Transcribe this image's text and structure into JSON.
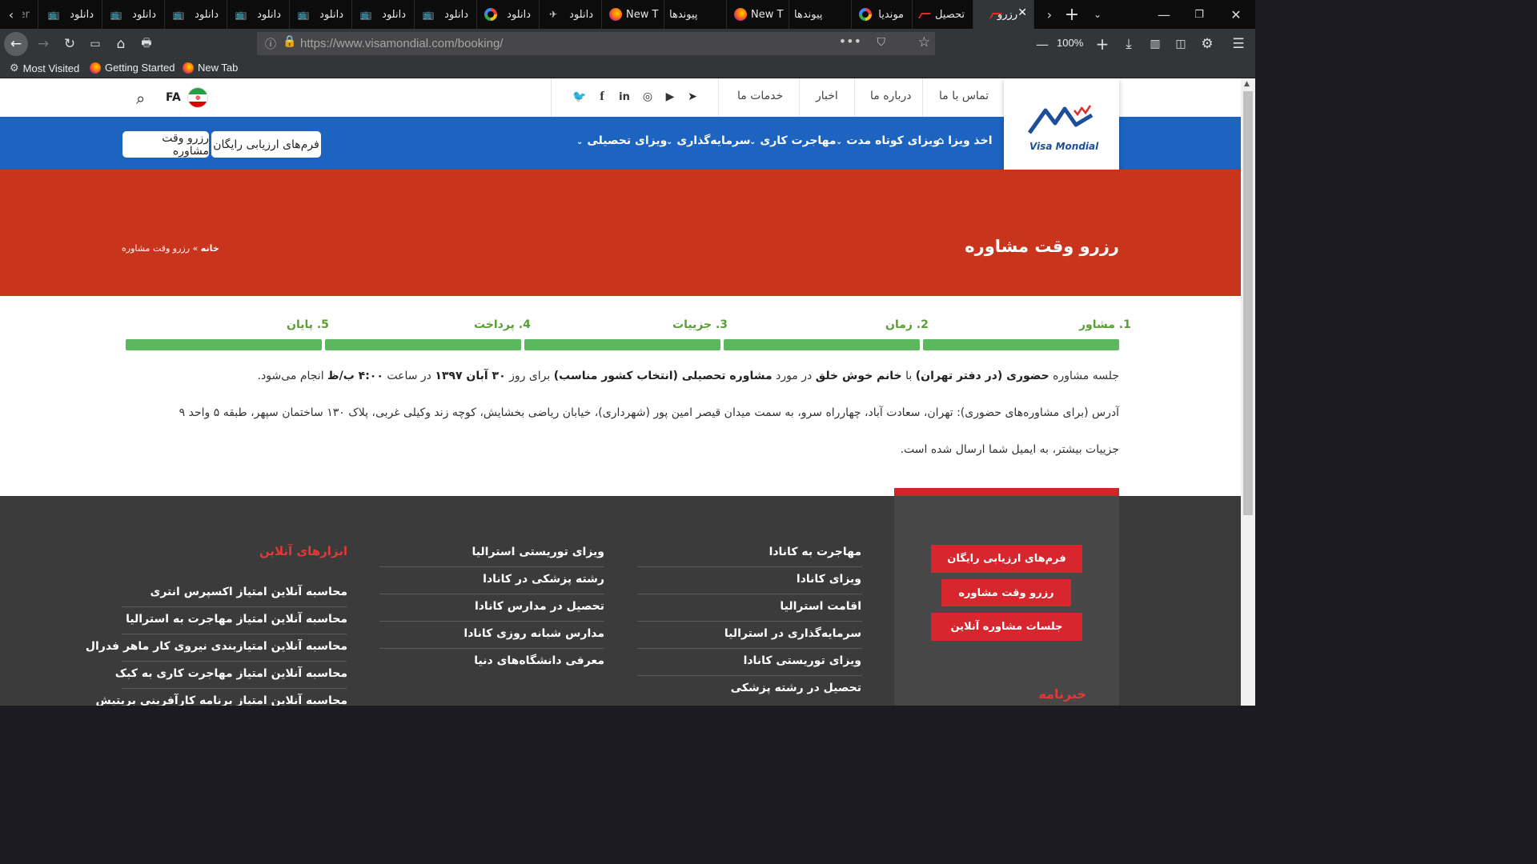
{
  "browser": {
    "tabs": [
      {
        "title": "er",
        "icon": "tv-icon"
      },
      {
        "title": "دانلود",
        "icon": "tv-icon"
      },
      {
        "title": "دانلود",
        "icon": "tv-icon"
      },
      {
        "title": "دانلود",
        "icon": "tv-icon"
      },
      {
        "title": "دانلود",
        "icon": "tv-icon"
      },
      {
        "title": "دانلود",
        "icon": "tv-icon"
      },
      {
        "title": "دانلود",
        "icon": "tv-icon"
      },
      {
        "title": "دانلود",
        "icon": "tv-icon"
      },
      {
        "title": "دانلود",
        "icon": "google-icon"
      },
      {
        "title": "دانلود",
        "icon": "plane-icon"
      },
      {
        "title": "New T",
        "icon": "firefox-icon"
      },
      {
        "title": "پیوندها",
        "icon": "none"
      },
      {
        "title": "New T",
        "icon": "firefox-icon"
      },
      {
        "title": "پیوندها",
        "icon": "none"
      },
      {
        "title": "موندیا",
        "icon": "google-icon"
      },
      {
        "title": "تحصیل",
        "icon": "visamondial-icon"
      },
      {
        "title": "رزرو",
        "icon": "visamondial-icon",
        "active": true
      }
    ],
    "url": "https://www.visamondial.com/booking/",
    "zoom": "100%",
    "bookmarks": [
      "Most Visited",
      "Getting Started",
      "New Tab"
    ]
  },
  "site": {
    "logo_text": "Visa Mondial",
    "top_links": [
      "تماس با ما",
      "درباره ما",
      "اخبار",
      "خدمات ما"
    ],
    "lang": "FA",
    "main_menu": [
      {
        "label": "اخذ ویزا",
        "has_dropdown": false
      },
      {
        "label": "ویزای کوتاه مدت",
        "has_dropdown": true
      },
      {
        "label": "مهاجرت کاری",
        "has_dropdown": true
      },
      {
        "label": "سرمایه‌گذاری",
        "has_dropdown": true
      },
      {
        "label": "ویزای تحصیلی",
        "has_dropdown": true
      }
    ],
    "cta_forms": "فرم‌های ارزیابی رایگان",
    "cta_booking": "رزرو وقت مشاوره",
    "page_title": "رزرو وقت مشاوره",
    "breadcrumb_home": "خانه",
    "breadcrumb_sep": "»",
    "breadcrumb_current": "رزرو وقت مشاوره",
    "steps": [
      "1. مشاور",
      "2. زمان",
      "3. جزییات",
      "4. پرداخت",
      "5. پایان"
    ],
    "session": {
      "p1": "جلسه مشاوره",
      "type": "حضوری (در دفتر تهران)",
      "p2": "با",
      "consultant": "خانم خوش خلق",
      "p3": "در مورد",
      "topic": "مشاوره تحصیلی (انتخاب کشور مناسب)",
      "p4": "برای روز",
      "date": "۳۰ آبان ۱۳۹۷",
      "p5": "در ساعت",
      "time": "۴:۰۰ ب/ظ",
      "p6": "انجام می‌شود."
    },
    "address": "آدرس (برای مشاوره‌های حضوری): تهران، سعادت آباد، چهارراه سرو، به سمت میدان قیصر امین پور (شهرداری)، خیابان ریاضی بخشایش، کوچه زند وکیلی غربی، پلاک ۱۳۰ ساختمان سپهر، طبقه ۵ واحد ۹",
    "email_note": "جزییات بیشتر، به ایمیل شما ارسال شده است."
  },
  "footer": {
    "buttons": [
      "فرم‌های ارزیابی رایگان",
      "رزرو وقت مشاوره",
      "جلسات مشاوره آنلاین"
    ],
    "newsletter": "خبرنامه",
    "col1": [
      "مهاجرت به کانادا",
      "ویزای کانادا",
      "اقامت استرالیا",
      "سرمایه‌گذاری در استرالیا",
      "ویزای توریستی کانادا",
      "تحصیل در رشته پزشکی"
    ],
    "col2": [
      "ویزای توریستی استرالیا",
      "رشته پزشکی در کانادا",
      "تحصیل در مدارس کانادا",
      "مدارس شبانه روزی کانادا",
      "معرفی دانشگاه‌های دنیا"
    ],
    "tools_title": "ابزارهای آنلاین",
    "tools": [
      "محاسبه آنلاین امتیاز اکسپرس انتری",
      "محاسبه آنلاین امتیاز مهاجرت به استرالیا",
      "محاسبه آنلاین امتیازبندی نیروی کار ماهر فدرال",
      "محاسبه آنلاین امتیاز مهاجرت کاری به کبک",
      "محاسبه آنلاین امتیاز برنامه کارآفرینی بریتیش"
    ]
  }
}
